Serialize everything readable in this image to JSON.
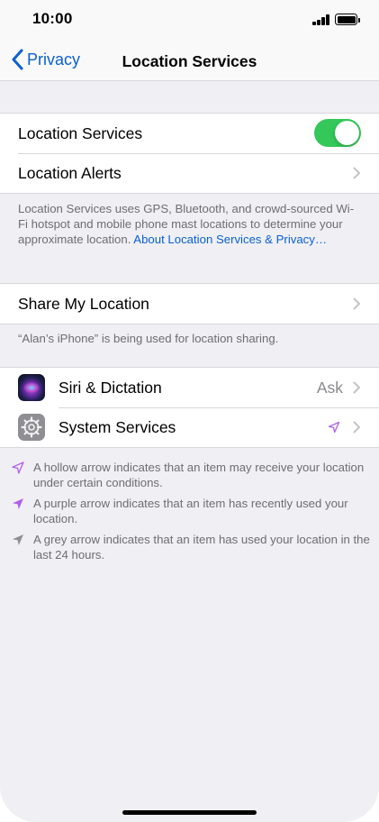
{
  "status": {
    "time": "10:00"
  },
  "nav": {
    "back_label": "Privacy",
    "title": "Location Services"
  },
  "group1": {
    "location_services": {
      "label": "Location Services",
      "toggle_on": true
    },
    "location_alerts": {
      "label": "Location Alerts"
    }
  },
  "description": {
    "text": "Location Services uses GPS, Bluetooth, and crowd-sourced Wi-Fi hotspot and mobile phone mast locations to determine your approximate location. ",
    "link": "About Location Services & Privacy…"
  },
  "group2": {
    "share_my_location": {
      "label": "Share My Location"
    }
  },
  "share_note": "“Alan’s iPhone” is being used for location sharing.",
  "group3": {
    "siri": {
      "label": "Siri & Dictation",
      "value": "Ask"
    },
    "system_services": {
      "label": "System Services"
    }
  },
  "legend": [
    {
      "icon": "hollow-arrow-icon",
      "text": "A hollow arrow indicates that an item may receive your location under certain conditions."
    },
    {
      "icon": "purple-arrow-icon",
      "text": "A purple arrow indicates that an item has recently used your location."
    },
    {
      "icon": "grey-arrow-icon",
      "text": "A grey arrow indicates that an item has used your location in the last 24 hours."
    }
  ],
  "colors": {
    "accent": "#0a60d0",
    "toggle_on": "#34c759",
    "purple_arrow": "#b15ee6",
    "grey_arrow": "#8e8e93"
  }
}
